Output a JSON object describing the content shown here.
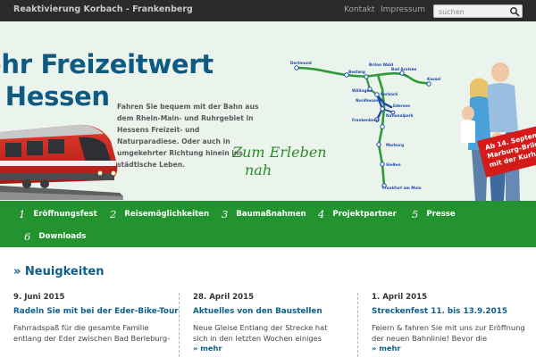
{
  "header": {
    "site_title": "Reaktivierung Korbach - Frankenberg",
    "links": [
      "Kontakt",
      "Impressum"
    ],
    "search_placeholder": "suchen"
  },
  "banner": {
    "headline": [
      "ehr Freizeitwert",
      "r Hessen"
    ],
    "intro": "Fahren Sie bequem mit der Bahn aus dem Rhein-Main- und Ruhrgebiet in Hessens Freizeit- und Naturparadiese. Oder auch in umgekehrter Richtung hinein ins städtische Leben.",
    "slogan": [
      "Zum Erleben",
      "nah"
    ],
    "map_stations": [
      "Dortmund",
      "Bestwig",
      "Brilon Wald",
      "Bad Arolsen",
      "Kassel",
      "Willingen",
      "Korbach",
      "Nordhessen",
      "Edersee",
      "Nationalpark",
      "Frankenberg",
      "Marburg",
      "Gießen",
      "Frankfurt am Main"
    ],
    "promo": [
      "Ab 14. Septem",
      "Marburg–Brilo",
      "mit der Kurhes"
    ]
  },
  "nav": {
    "items": [
      {
        "num": "1",
        "label": "Eröffnungsfest"
      },
      {
        "num": "2",
        "label": "Reisemöglichkeiten"
      },
      {
        "num": "3",
        "label": "Baumaßnahmen"
      },
      {
        "num": "4",
        "label": "Projektpartner"
      },
      {
        "num": "5",
        "label": "Presse"
      },
      {
        "num": "6",
        "label": "Downloads"
      }
    ]
  },
  "news": {
    "title": "» Neuigkeiten",
    "items": [
      {
        "date": "9. Juni 2015",
        "title": "Radeln Sie mit bei der Eder-Bike-Tour",
        "text": "Fahrradspaß für die gesamte Familie entlang der Eder zwischen Bad Berleburg-",
        "more": ""
      },
      {
        "date": "28. April 2015",
        "title": "Aktuelles von den Baustellen",
        "text": "Neue Gleise Entlang der Strecke hat sich in den letzten Wochen einiges",
        "more": "» mehr"
      },
      {
        "date": "1. April 2015",
        "title": "Streckenfest 11. bis 13.9.2015",
        "text": "Feiern & fahren Sie mit uns zur Eröffnung der neuen Bahnlinie! Bevor die",
        "more": "» mehr"
      }
    ]
  },
  "colors": {
    "topbar": "#2b2b2b",
    "banner_bg": "#eaf3ec",
    "headline": "#0e5a82",
    "nav_green": "#22932e",
    "link_blue": "#0b5f8a",
    "map_line_green": "#2d9a36",
    "map_line_blue": "#1f4aa8",
    "promo_red": "#d51a1a"
  },
  "icons": {
    "search": "magnifier-icon"
  }
}
